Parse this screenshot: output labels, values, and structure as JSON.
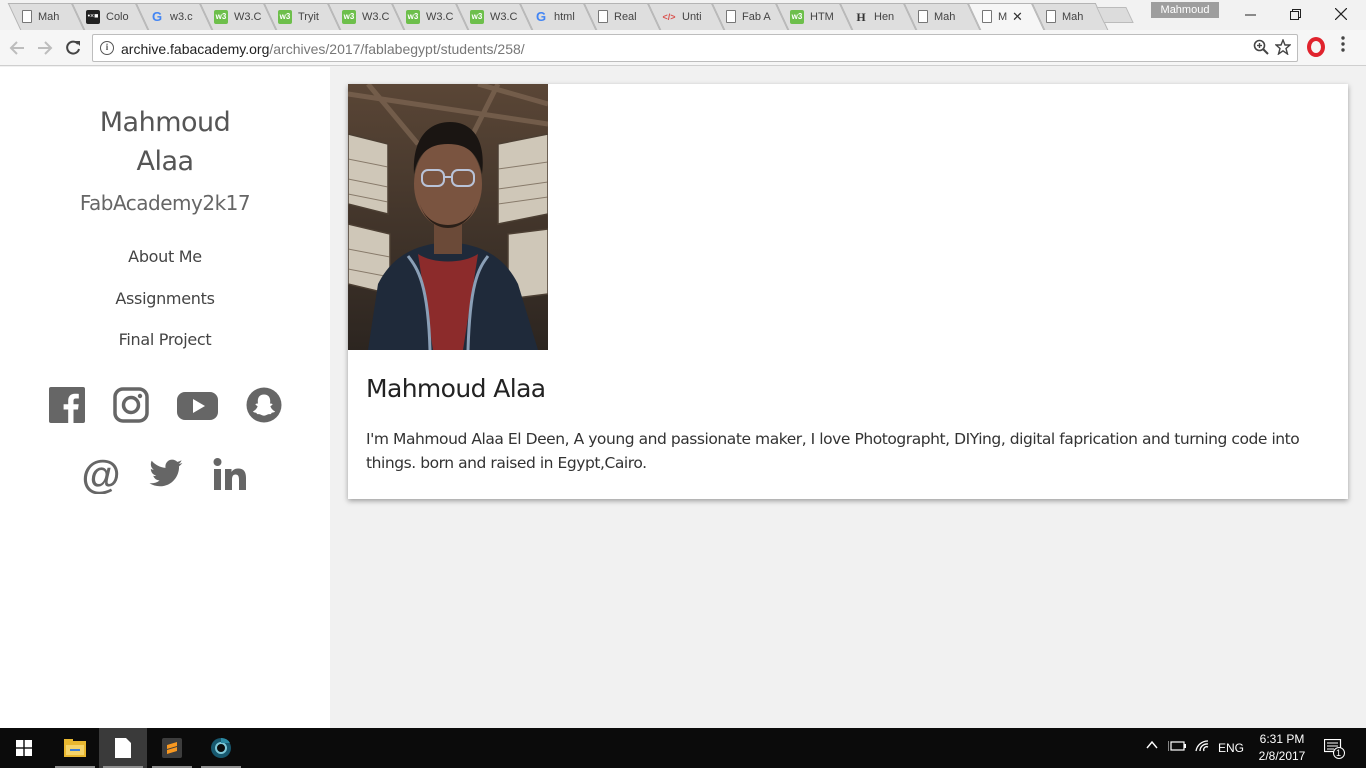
{
  "browser": {
    "tabs": [
      {
        "title": "Mah",
        "favicon": "doc-icon"
      },
      {
        "title": "Colo",
        "favicon": "oxo-icon"
      },
      {
        "title": "w3.c",
        "favicon": "google-icon"
      },
      {
        "title": "W3.C",
        "favicon": "w3schools-icon"
      },
      {
        "title": "Tryit",
        "favicon": "w3schools-icon"
      },
      {
        "title": "W3.C",
        "favicon": "w3schools-icon"
      },
      {
        "title": "W3.C",
        "favicon": "w3schools-icon"
      },
      {
        "title": "W3.C",
        "favicon": "w3schools-icon"
      },
      {
        "title": "html",
        "favicon": "google-icon"
      },
      {
        "title": "Real",
        "favicon": "doc-icon"
      },
      {
        "title": "Unti",
        "favicon": "code-icon"
      },
      {
        "title": "Fab A",
        "favicon": "doc-icon"
      },
      {
        "title": "HTM",
        "favicon": "w3schools-icon"
      },
      {
        "title": "Hen",
        "favicon": "h-icon"
      },
      {
        "title": "Mah",
        "favicon": "doc-icon"
      },
      {
        "title": "M",
        "favicon": "doc-icon",
        "active": true
      },
      {
        "title": "Mah",
        "favicon": "doc-icon"
      }
    ],
    "profile_name": "Mahmoud",
    "url_host": "archive.fabacademy.org",
    "url_path": "/archives/2017/fablabegypt/students/258/"
  },
  "sidebar": {
    "name_line1": "Mahmoud",
    "name_line2": "Alaa",
    "subtitle": "FabAcademy2k17",
    "nav": [
      {
        "label": "About Me"
      },
      {
        "label": "Assignments"
      },
      {
        "label": "Final Project"
      }
    ],
    "social_row1": [
      "facebook-icon",
      "instagram-icon",
      "youtube-icon",
      "snapchat-icon"
    ],
    "social_row2": [
      "email-at-icon",
      "twitter-icon",
      "linkedin-icon"
    ],
    "icon_color": "#666666"
  },
  "main": {
    "title": "Mahmoud Alaa",
    "bio": "I'm Mahmoud Alaa El Deen, A young and passionate maker, I love Photographt, DIYing, digital faprication and turning code into things. born and raised in Egypt,Cairo."
  },
  "taskbar": {
    "time": "6:31 PM",
    "date": "2/8/2017",
    "language": "ENG",
    "notification_count": "1"
  }
}
